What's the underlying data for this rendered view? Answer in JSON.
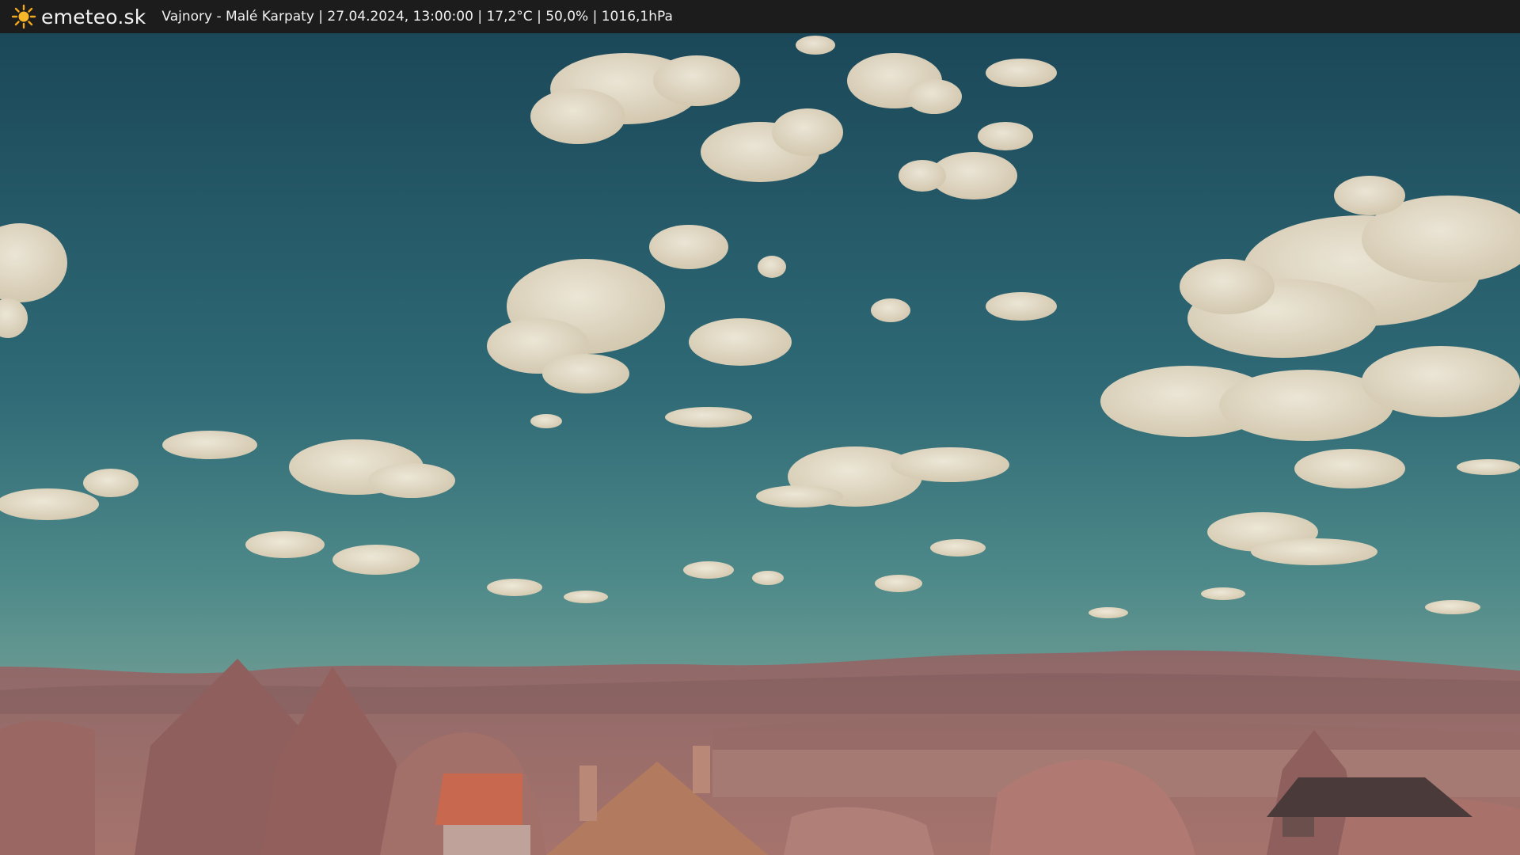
{
  "header": {
    "brand": "emeteo.sk",
    "brand_icon": "sun-icon",
    "caption": "Vajnory - Malé Karpaty | 27.04.2024, 13:00:00 | 17,2°C | 50,0% | 1016,1hPa"
  },
  "colors": {
    "bar": "#1c1c1c",
    "sky_top": "#1d4a5c",
    "sky_bottom": "#4f8a8a",
    "cloud": "#efe4cf",
    "hills": "#8a6262",
    "foliage": "#a9706a",
    "roof": "#c8684f",
    "sun": "#f4a81c"
  }
}
